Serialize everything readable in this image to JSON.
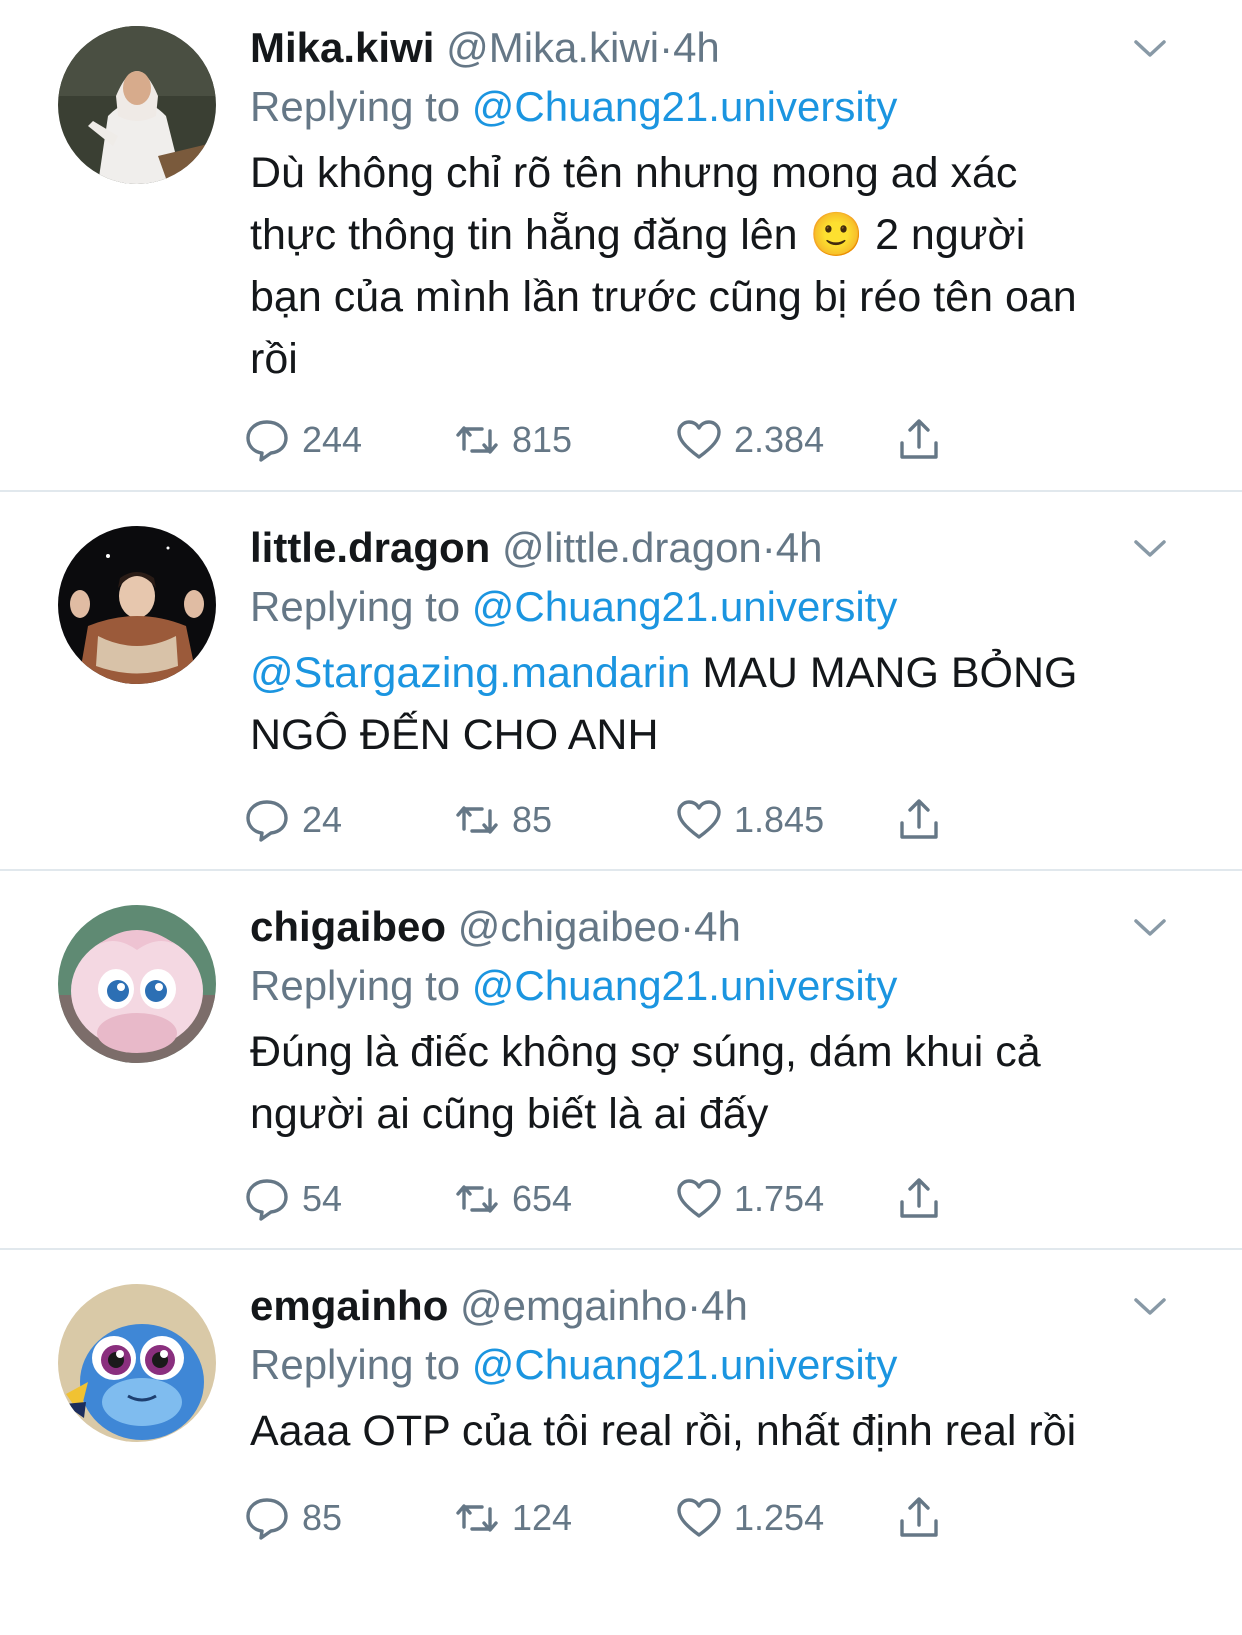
{
  "tweets": [
    {
      "name": "Mika.kiwi",
      "handle": "@Mika.kiwi",
      "time": "4h",
      "replying_prefix": "Replying to",
      "replying_to": "@Chuang21.university",
      "text_lines": [
        "Dù không chỉ rõ tên nhưng mong ad xác",
        "thực thông tin hẵng đăng lên",
        "2 người",
        "bạn của mình lần trước cũng bị réo tên oan",
        "rồi"
      ],
      "emoji": "🙂",
      "replies": "244",
      "retweets": "815",
      "likes": "2.384"
    },
    {
      "name": "little.dragon",
      "handle": "@little.dragon",
      "time": "4h",
      "replying_prefix": "Replying to",
      "replying_to": "@Chuang21.university",
      "text_mention": "@Stargazing.mandarin",
      "text_lines": [
        "MAU MANG BỎNG",
        "NGÔ ĐẾN CHO ANH"
      ],
      "replies": "24",
      "retweets": "85",
      "likes": "1.845"
    },
    {
      "name": "chigaibeo",
      "handle": "@chigaibeo",
      "time": "4h",
      "replying_prefix": "Replying to",
      "replying_to": "@Chuang21.university",
      "text_lines": [
        "Đúng là điếc không sợ súng, dám khui cả",
        "người ai cũng biết là ai đấy"
      ],
      "replies": "54",
      "retweets": "654",
      "likes": "1.754"
    },
    {
      "name": "emgainho",
      "handle": "@emgainho",
      "time": "4h",
      "replying_prefix": "Replying to",
      "replying_to": "@Chuang21.university",
      "text_lines": [
        "Aaaa OTP của tôi real rồi, nhất định real rồi"
      ],
      "replies": "85",
      "retweets": "124",
      "likes": "1.254"
    }
  ],
  "separator": "·",
  "icons": {
    "reply": "reply-icon",
    "retweet": "retweet-icon",
    "like": "heart-icon",
    "share": "share-icon",
    "menu": "chevron-down-icon"
  },
  "colors": {
    "link": "#1b95e0",
    "muted": "#657786",
    "text": "#14171a",
    "divider": "#e1e8ed"
  }
}
